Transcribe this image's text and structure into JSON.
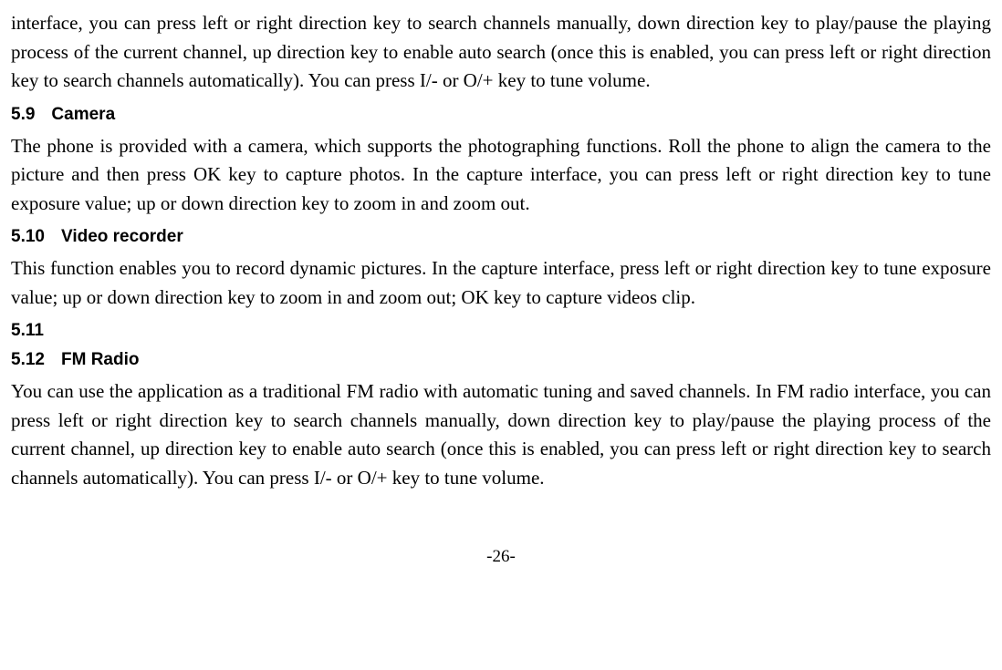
{
  "p1": "interface, you can press left or right direction key to search channels manually, down direction key to play/pause the playing process of the current channel, up direction key to enable auto search (once this is enabled, you can press left or right direction key to search channels automatically). You can press I/- or O/+ key to tune volume.",
  "h59_num": "5.9",
  "h59_title": "Camera",
  "p59": "The phone is provided with a camera, which supports the photographing functions. Roll the phone to align the camera to the picture and then press OK key to capture photos. In the capture interface, you can press left or right direction key to tune exposure value; up or down direction key to zoom in and zoom out.",
  "h510_num": "5.10",
  "h510_title": "Video recorder",
  "p510": "This function enables you to record dynamic pictures. In the capture interface, press left or right direction key to tune exposure value; up or down direction key to zoom in and zoom out; OK key to capture videos clip.",
  "h511_num": "5.11",
  "h512_num": "5.12",
  "h512_title": "FM Radio",
  "p512": "You can use the application as a traditional FM radio with automatic tuning and saved channels. In FM radio interface, you can press left or right direction key to search channels manually, down direction key to play/pause the playing process of the current channel, up direction key to enable auto search (once this is enabled, you can press left or right direction key to search channels automatically). You can press I/- or O/+ key to tune volume.",
  "page_number": "-26-"
}
